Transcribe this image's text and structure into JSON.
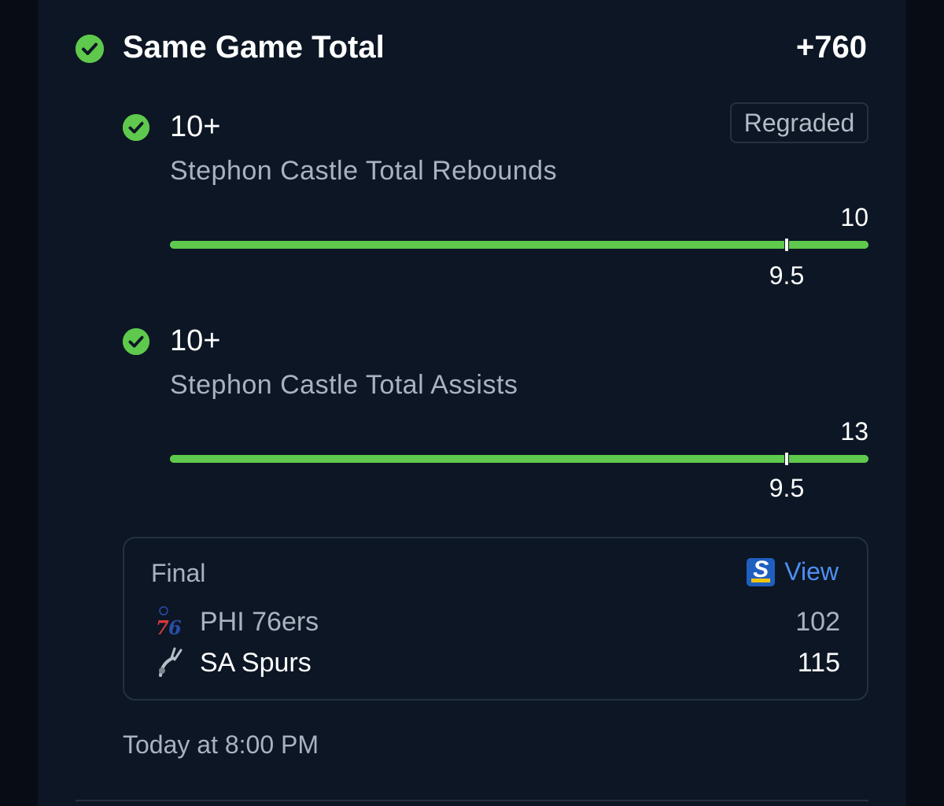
{
  "parlay": {
    "title": "Same Game Total",
    "odds": "+760",
    "status_color": "#5ec94c"
  },
  "legs": [
    {
      "line": "10+",
      "market": "Stephon Castle Total Rebounds",
      "badge": "Regraded",
      "actual": "10",
      "threshold": "9.5",
      "progress_fraction": 1.0
    },
    {
      "line": "10+",
      "market": "Stephon Castle Total Assists",
      "actual": "13",
      "threshold": "9.5",
      "progress_fraction": 1.0
    }
  ],
  "game": {
    "status": "Final",
    "view_label": "View",
    "teams": [
      {
        "name": "PHI 76ers",
        "score": "102",
        "logo": "76ers-logo"
      },
      {
        "name": "SA Spurs",
        "score": "115",
        "logo": "spurs-logo"
      }
    ]
  },
  "timestamp": "Today at 8:00 PM",
  "colors": {
    "accent_green": "#5ec94c",
    "link_blue": "#4d8ff2",
    "background": "#0c1624"
  }
}
